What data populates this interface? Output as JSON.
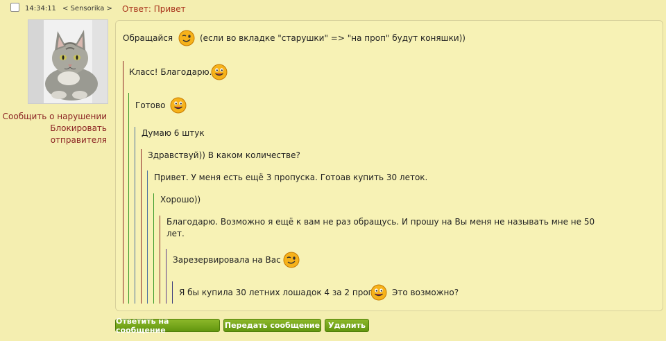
{
  "header": {
    "time": "14:34:11",
    "sender": "Sensorika",
    "subject": "Ответ: Привет"
  },
  "sidebar": {
    "report_link": "Сообщить о нарушении",
    "block_link_line1": "Блокировать",
    "block_link_line2": "отправителя"
  },
  "message": {
    "lines": [
      {
        "before": "Обращайся",
        "after": "(если во вкладке \"старушки\" => \"на проп\" будут коняшки))"
      },
      {
        "text": "Класс! Благодарю."
      },
      {
        "text": "Готово"
      },
      {
        "text": "Думаю 6 штук"
      },
      {
        "text": "Здравствуй)) В каком количестве?"
      },
      {
        "text": "Привет. У меня есть ещё 3 пропуска. Готоав купить 30 леток."
      },
      {
        "text": "Хорошо))"
      },
      {
        "text": "Благодарю. Возможно я ещё к вам не раз обращусь. И прошу на Вы меня не называть мне не 50"
      },
      {
        "text": "лет."
      },
      {
        "text": "Зарезервировала на Вас"
      },
      {
        "before": "Я бы купила 30 летних лошадок 4 за 2 пропа",
        "after": "Это возможно?"
      }
    ]
  },
  "buttons": {
    "reply": "Ответить на сообщение",
    "forward": "Передать сообщение",
    "delete": "Удалить"
  },
  "icons": {
    "wink": "wink-smiley-icon",
    "smile": "smile-smiley-icon"
  }
}
